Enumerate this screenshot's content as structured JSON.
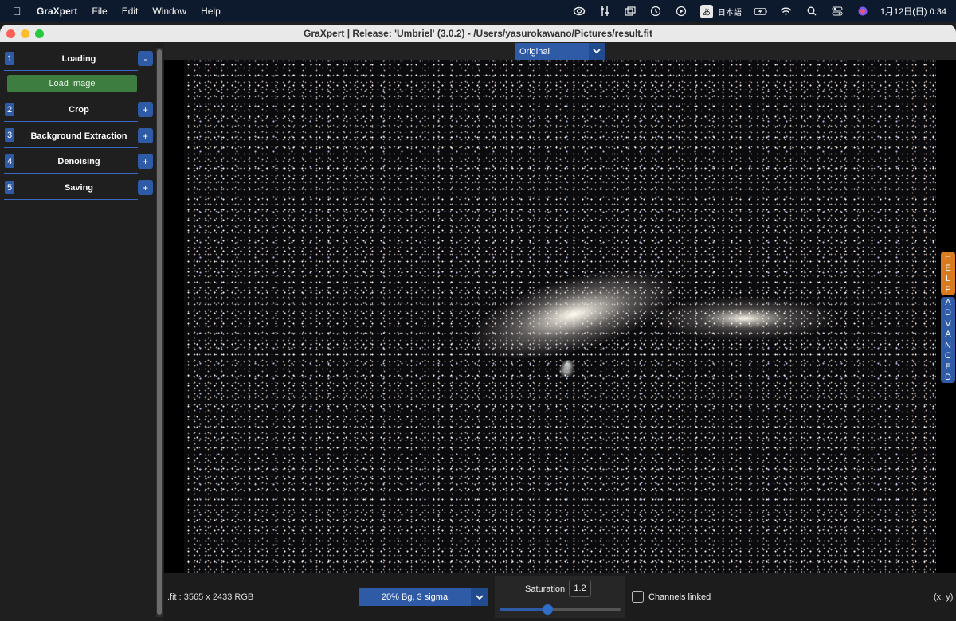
{
  "menubar": {
    "app_name": "GraXpert",
    "menus": [
      "File",
      "Edit",
      "Window",
      "Help"
    ],
    "ime_badge": "あ",
    "language": "日本語",
    "clock": "1月12日(日)  0:34"
  },
  "window": {
    "title": "GraXpert | Release: 'Umbriel' (3.0.2) - /Users/yasurokawano/Pictures/result.fit"
  },
  "sidebar": {
    "sections": [
      {
        "num": "1",
        "title": "Loading",
        "toggle": "-"
      },
      {
        "num": "2",
        "title": "Crop",
        "toggle": "+"
      },
      {
        "num": "3",
        "title": "Background Extraction",
        "toggle": "+"
      },
      {
        "num": "4",
        "title": "Denoising",
        "toggle": "+"
      },
      {
        "num": "5",
        "title": "Saving",
        "toggle": "+"
      }
    ],
    "load_button": "Load Image"
  },
  "view": {
    "selected": "Original"
  },
  "side_tabs": {
    "help": [
      "H",
      "E",
      "L",
      "P"
    ],
    "advanced": [
      "A",
      "D",
      "V",
      "A",
      "N",
      "C",
      "E",
      "D"
    ]
  },
  "bottom": {
    "file_info": ".fit : 3565 x 2433 RGB",
    "stretch_selected": "20% Bg, 3 sigma",
    "saturation_label": "Saturation",
    "saturation_value": "1.2",
    "saturation_fraction": 0.4,
    "channels_linked_label": "Channels linked",
    "channels_linked": false,
    "coords": "(x, y)"
  },
  "colors": {
    "accent_blue": "#2f5aa6",
    "load_green": "#3d7d3f",
    "help_orange": "#d97a1f"
  }
}
